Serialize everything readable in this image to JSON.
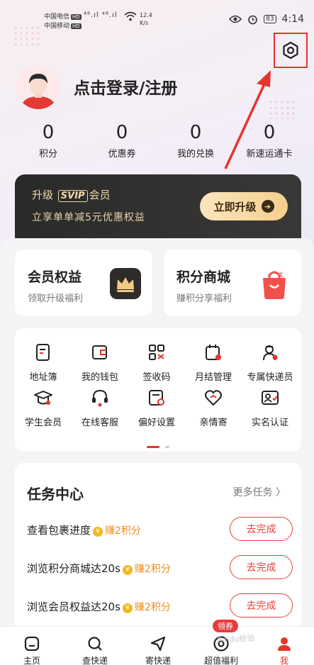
{
  "status_bar": {
    "carrier1": "中国电信",
    "carrier2": "中国移动",
    "hd": "HD",
    "signal": "⁴⁶.ıl ⁴⁶.ıl",
    "speed_value": "12.4",
    "speed_unit": "K/s",
    "battery": "83",
    "time": "4:14"
  },
  "profile": {
    "login_text": "点击登录/注册"
  },
  "stats": [
    {
      "value": "0",
      "label": "积分"
    },
    {
      "value": "0",
      "label": "优惠券"
    },
    {
      "value": "0",
      "label": "我的兑换"
    },
    {
      "value": "0",
      "label": "新速运通卡"
    }
  ],
  "svip": {
    "prefix": "升级",
    "badge": "SVIP",
    "suffix": "会员",
    "desc": "立享单单减5元优惠权益",
    "button": "立即升级"
  },
  "cards": [
    {
      "title": "会员权益",
      "sub": "领取升级福利"
    },
    {
      "title": "积分商城",
      "sub": "赚积分享福利"
    }
  ],
  "grid": [
    {
      "label": "地址簿",
      "icon": "address-book-icon"
    },
    {
      "label": "我的钱包",
      "icon": "wallet-icon"
    },
    {
      "label": "签收码",
      "icon": "qr-code-icon"
    },
    {
      "label": "月结管理",
      "icon": "calendar-icon"
    },
    {
      "label": "专属快递员",
      "icon": "courier-icon"
    },
    {
      "label": "学生会员",
      "icon": "graduation-cap-icon"
    },
    {
      "label": "在线客服",
      "icon": "headset-icon"
    },
    {
      "label": "偏好设置",
      "icon": "preference-icon"
    },
    {
      "label": "亲情寄",
      "icon": "heart-link-icon"
    },
    {
      "label": "实名认证",
      "icon": "id-card-icon"
    }
  ],
  "tasks": {
    "title": "任务中心",
    "more": "更多任务",
    "items": [
      {
        "name": "查看包裹进度",
        "reward": "赚2积分",
        "button": "去完成"
      },
      {
        "name": "浏览积分商城达20s",
        "reward": "赚2积分",
        "button": "去完成"
      },
      {
        "name": "浏览会员权益达20s",
        "reward": "赚2积分",
        "button": "去完成"
      }
    ]
  },
  "nav": {
    "items": [
      {
        "label": "主页",
        "icon": "home-icon"
      },
      {
        "label": "查快递",
        "icon": "search-icon"
      },
      {
        "label": "寄快递",
        "icon": "send-icon"
      },
      {
        "label": "超值福利",
        "icon": "target-icon"
      },
      {
        "label": "我",
        "icon": "profile-icon"
      }
    ],
    "coupon_badge": "领券",
    "watermark": "Baidu经验"
  },
  "colors": {
    "accent_red": "#e5352b",
    "gold": "#f3d9a6",
    "reward_orange": "#f08c1a"
  }
}
